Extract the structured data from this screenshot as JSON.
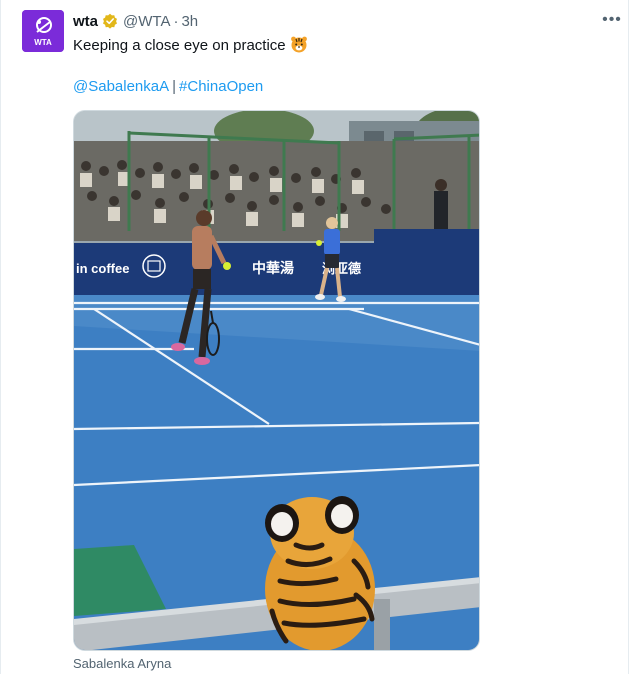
{
  "tweet": {
    "author_name": "wta",
    "author_handle": "@WTA",
    "separator": "·",
    "time": "3h",
    "text": "Keeping a close eye on practice",
    "mention": "@SabalenkaA",
    "divider": "|",
    "hashtag": "#ChinaOpen",
    "avatar_text": "WTA",
    "more_label": "•••"
  },
  "media": {
    "banner_left": "in coffee",
    "banner_mid": "中華湯",
    "banner_right": "浏亚德"
  },
  "caption": "Sabalenka Aryna",
  "colors": {
    "avatar_bg": "#7b2bd9",
    "link": "#1d9bf0",
    "verified": "#e2b719",
    "court": "#3d7fc3",
    "banner": "#1c3a78"
  }
}
